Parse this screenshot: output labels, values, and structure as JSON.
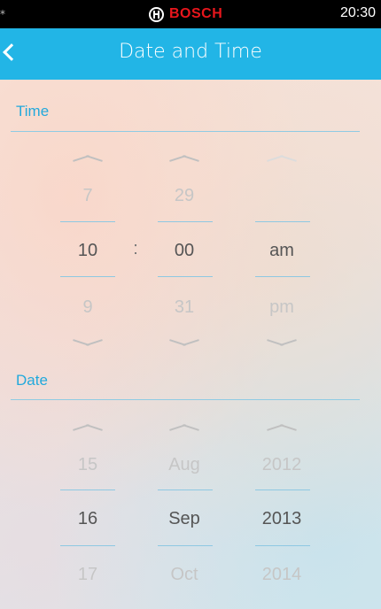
{
  "status_bar": {
    "left_mark": "*",
    "brand": "BOSCH",
    "time": "20:30"
  },
  "header": {
    "title": "Date and Time"
  },
  "time_section": {
    "label": "Time",
    "hour": {
      "prev": "7",
      "value": "10",
      "next": "9"
    },
    "separator": ":",
    "minute": {
      "prev": "29",
      "value": "00",
      "next": "31"
    },
    "period": {
      "value": "am",
      "next": "pm"
    }
  },
  "date_section": {
    "label": "Date",
    "day": {
      "prev": "15",
      "value": "16",
      "next": "17"
    },
    "month": {
      "prev": "Aug",
      "value": "Sep",
      "next": "Oct"
    },
    "year": {
      "prev": "2012",
      "value": "2013",
      "next": "2014"
    }
  },
  "icons": {
    "back": "chevron-left-icon",
    "increment": "chevron-up-icon",
    "decrement": "chevron-down-icon",
    "brand_logo": "bosch-logo-icon"
  },
  "colors": {
    "accent": "#22b5e6",
    "section_label": "#22a9dc",
    "brand_red": "#e8161c",
    "status_bar": "#000000"
  }
}
